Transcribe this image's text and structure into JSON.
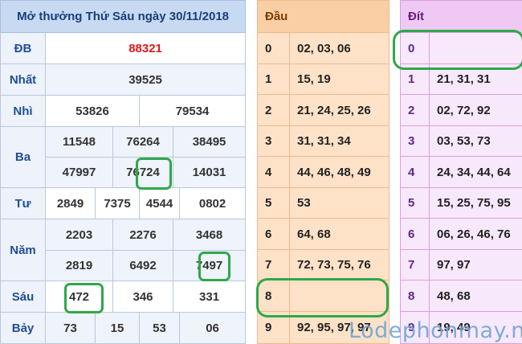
{
  "results": {
    "title": "Mở thưởng Thứ Sáu ngày 30/11/2018",
    "rows": {
      "db": {
        "label": "ĐB",
        "values": [
          "88321"
        ]
      },
      "nhat": {
        "label": "Nhất",
        "values": [
          "39525"
        ]
      },
      "nhi": {
        "label": "Nhì",
        "values": [
          "53826",
          "79534"
        ]
      },
      "ba": {
        "label": "Ba",
        "values": [
          "11548",
          "76264",
          "38495",
          "47997",
          "76724",
          "14031"
        ]
      },
      "tu": {
        "label": "Tư",
        "values": [
          "2849",
          "7375",
          "4544",
          "0802"
        ]
      },
      "nam": {
        "label": "Năm",
        "values": [
          "2203",
          "2276",
          "3468",
          "2819",
          "6492",
          "7497"
        ]
      },
      "sau": {
        "label": "Sáu",
        "values": [
          "472",
          "346",
          "331"
        ]
      },
      "bay": {
        "label": "Bảy",
        "values": [
          "73",
          "15",
          "53",
          "06"
        ]
      }
    }
  },
  "dau": {
    "header": "Đầu",
    "rows": [
      {
        "key": "0",
        "values": "02, 03, 06"
      },
      {
        "key": "1",
        "values": "15, 19"
      },
      {
        "key": "2",
        "values": "21, 24, 25, 26"
      },
      {
        "key": "3",
        "values": "31, 31, 34"
      },
      {
        "key": "4",
        "values": "44, 46, 48, 49"
      },
      {
        "key": "5",
        "values": "53"
      },
      {
        "key": "6",
        "values": "64, 68"
      },
      {
        "key": "7",
        "values": "72, 73, 75, 76"
      },
      {
        "key": "8",
        "values": ""
      },
      {
        "key": "9",
        "values": "92, 95, 97, 97"
      }
    ]
  },
  "dit": {
    "header": "Đít",
    "rows": [
      {
        "key": "0",
        "values": ""
      },
      {
        "key": "1",
        "values": "21, 31, 31"
      },
      {
        "key": "2",
        "values": "02, 72, 92"
      },
      {
        "key": "3",
        "values": "03, 53, 73"
      },
      {
        "key": "4",
        "values": "24, 34, 44, 64"
      },
      {
        "key": "5",
        "values": "15, 25, 75, 95"
      },
      {
        "key": "6",
        "values": "06, 26, 46, 76"
      },
      {
        "key": "7",
        "values": "97, 97"
      },
      {
        "key": "8",
        "values": "48, 68"
      },
      {
        "key": "9",
        "values": "19, 49"
      }
    ]
  },
  "watermark": "Lodephonmay.net",
  "colors": {
    "highlight_ring": "#2fa84a",
    "special_prize": "#e21a1a",
    "label_blue": "#1f4e96",
    "dau_bg": "#fde2c8",
    "dit_bg": "#f8e8fb"
  }
}
